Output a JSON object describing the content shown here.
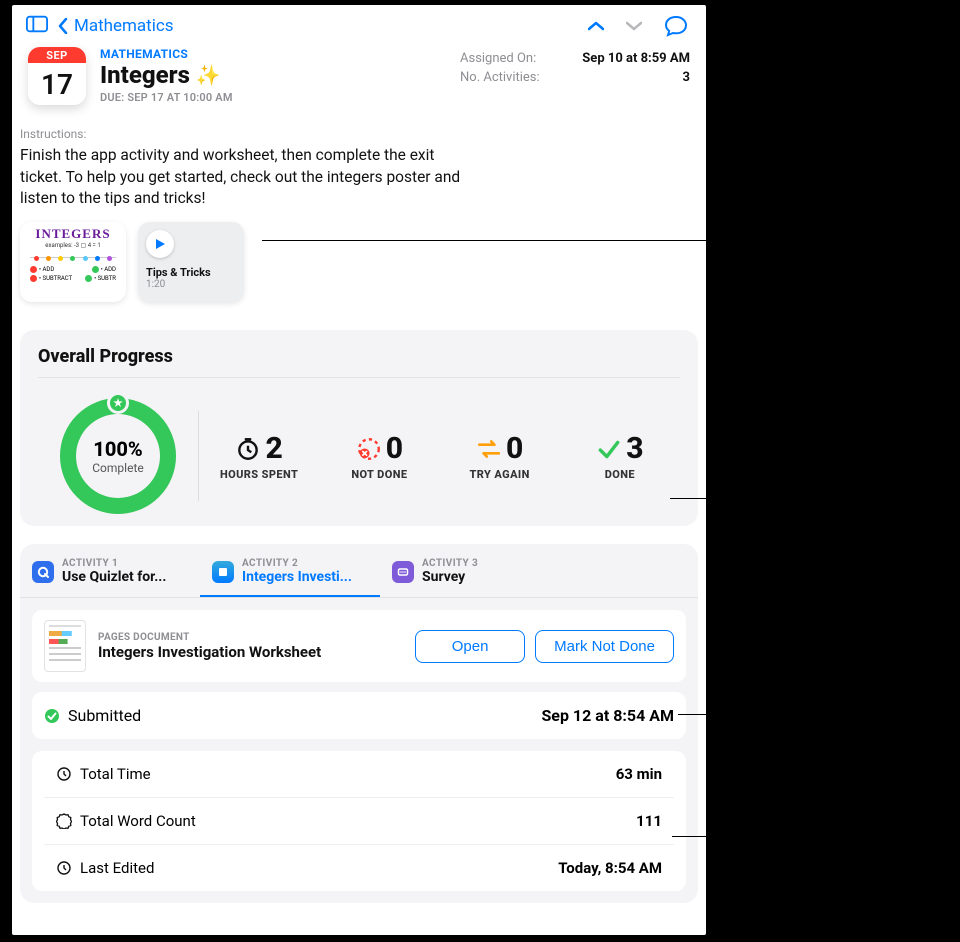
{
  "nav": {
    "back_label": "Mathematics"
  },
  "date_tile": {
    "month": "SEP",
    "day": "17"
  },
  "header": {
    "eyebrow": "MATHEMATICS",
    "title": "Integers",
    "due": "DUE: SEP 17 AT 10:00 AM"
  },
  "meta": {
    "assigned_label": "Assigned On:",
    "assigned_value": "Sep 10 at 8:59 AM",
    "activities_label": "No. Activities:",
    "activities_value": "3"
  },
  "instructions": {
    "label": "Instructions:",
    "text": "Finish the app activity and worksheet, then complete the exit ticket. To help you get started, check out the integers poster and listen to the tips and tricks!"
  },
  "attachments": {
    "poster": {
      "title": "INTEGERS",
      "examples_label": "EXAMPLES",
      "legend": [
        {
          "color": "#ff3b30",
          "label": "ADD"
        },
        {
          "color": "#34c759",
          "label": "ADD"
        },
        {
          "color": "#ff3b30",
          "label": "SUBTRACT"
        },
        {
          "color": "#34c759",
          "label": "SUBTR"
        }
      ]
    },
    "media": {
      "title": "Tips & Tricks",
      "duration": "1:20"
    }
  },
  "progress": {
    "heading": "Overall Progress",
    "percent": "100%",
    "complete_label": "Complete",
    "stats": {
      "hours": {
        "value": "2",
        "label": "HOURS SPENT"
      },
      "not_done": {
        "value": "0",
        "label": "NOT DONE"
      },
      "try_again": {
        "value": "0",
        "label": "TRY AGAIN"
      },
      "done": {
        "value": "3",
        "label": "DONE"
      }
    }
  },
  "tabs": [
    {
      "eyebrow": "ACTIVITY 1",
      "title": "Use Quizlet for...",
      "icon_bg": "#2f6fed",
      "selected": false
    },
    {
      "eyebrow": "ACTIVITY 2",
      "title": "Integers Investi...",
      "icon_bg": "#0a84ff",
      "selected": true
    },
    {
      "eyebrow": "ACTIVITY 3",
      "title": "Survey",
      "icon_bg": "#7d5bd9",
      "selected": false
    }
  ],
  "activity": {
    "doc_eyebrow": "PAGES DOCUMENT",
    "doc_title": "Integers Investigation Worksheet",
    "open_btn": "Open",
    "mark_btn": "Mark Not Done",
    "submitted": {
      "label": "Submitted",
      "value": "Sep 12 at 8:54 AM"
    },
    "details": {
      "total_time": {
        "label": "Total Time",
        "value": "63 min"
      },
      "word_count": {
        "label": "Total Word Count",
        "value": "111"
      },
      "last_edited": {
        "label": "Last Edited",
        "value": "Today, 8:54 AM"
      }
    }
  }
}
